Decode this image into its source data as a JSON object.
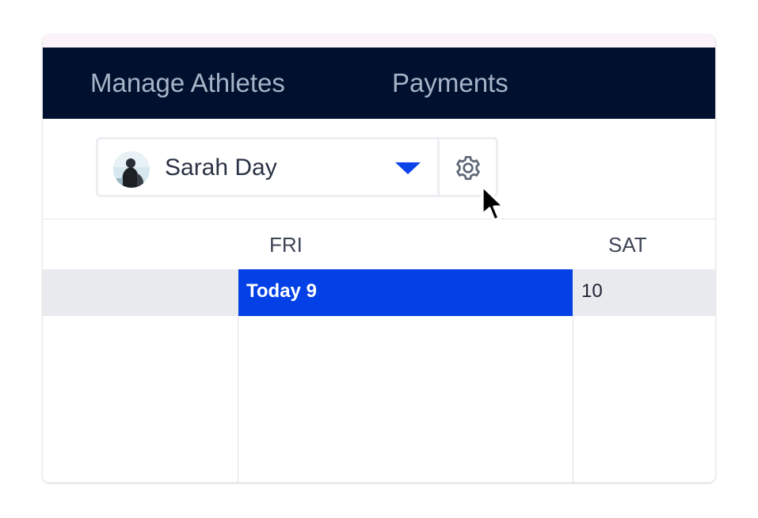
{
  "nav": {
    "items": [
      {
        "label": "Manage Athletes"
      },
      {
        "label": "Payments"
      }
    ]
  },
  "athlete_selector": {
    "selected_name": "Sarah Day",
    "avatar_icon": "athlete-avatar",
    "dropdown_icon": "caret-down-icon",
    "settings_icon": "gear-icon"
  },
  "calendar": {
    "days": [
      {
        "label": "FRI"
      },
      {
        "label": "SAT"
      }
    ],
    "dates": [
      {
        "label": "Today 9"
      },
      {
        "label": "10"
      }
    ]
  },
  "colors": {
    "nav_bg": "#00112f",
    "nav_text": "#a7b3c7",
    "accent": "#0340e6",
    "date_row_bg": "#e9eaee"
  }
}
